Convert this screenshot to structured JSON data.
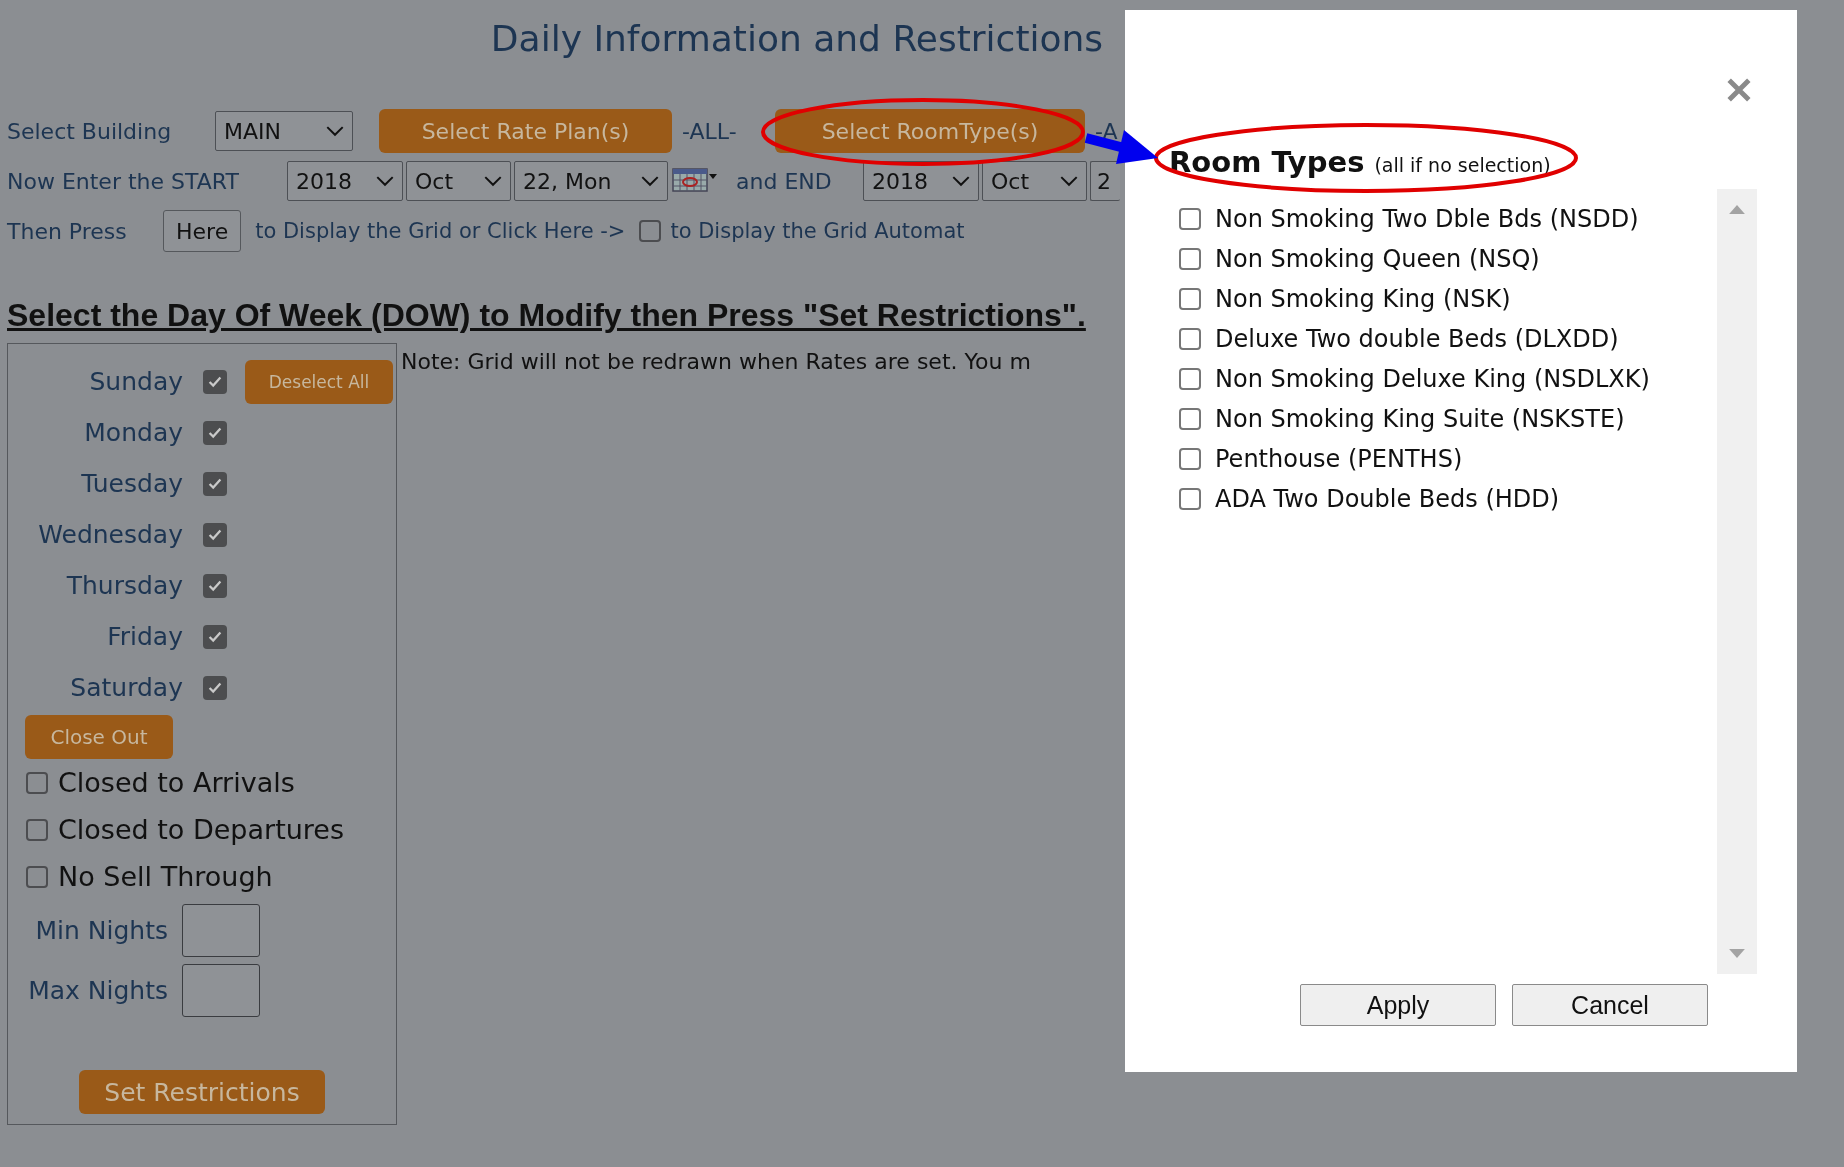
{
  "title": "Daily Information and Restrictions",
  "building": {
    "label": "Select Building",
    "value": "MAIN"
  },
  "rate_plan": {
    "button": "Select Rate Plan(s)",
    "value": "-ALL-"
  },
  "room_type": {
    "button": "Select RoomType(s)",
    "value": "-A"
  },
  "dates": {
    "start_label": "Now Enter the START",
    "start": [
      "2018",
      "Oct",
      "22, Mon"
    ],
    "end_label": "and END",
    "end": [
      "2018",
      "Oct",
      "2"
    ]
  },
  "display": {
    "prefix": "Then Press",
    "button": "Here",
    "middle": "to Display the Grid or Click Here ->",
    "auto_checked": false,
    "auto_label": "to Display the Grid Automat"
  },
  "heading": "Select the Day Of Week (DOW) to Modify then Press \"Set Restrictions\".",
  "note": "Note: Grid will not be redrawn when Rates are set. You m",
  "days": [
    {
      "label": "Sunday",
      "checked": true
    },
    {
      "label": "Monday",
      "checked": true
    },
    {
      "label": "Tuesday",
      "checked": true
    },
    {
      "label": "Wednesday",
      "checked": true
    },
    {
      "label": "Thursday",
      "checked": true
    },
    {
      "label": "Friday",
      "checked": true
    },
    {
      "label": "Saturday",
      "checked": true
    }
  ],
  "deselect_button": "Deselect All",
  "close_out_button": "Close Out",
  "restrictions": [
    {
      "label": "Closed to Arrivals",
      "checked": false
    },
    {
      "label": "Closed to Departures",
      "checked": false
    },
    {
      "label": "No Sell Through",
      "checked": false
    }
  ],
  "nights": [
    {
      "label": "Min Nights"
    },
    {
      "label": "Max Nights"
    }
  ],
  "set_button": "Set Restrictions",
  "modal": {
    "title": "Room Types",
    "hint": "(all if no selection)",
    "room_types": [
      {
        "label": "Non Smoking Two Dble Bds (NSDD)",
        "checked": false
      },
      {
        "label": "Non Smoking Queen (NSQ)",
        "checked": false
      },
      {
        "label": "Non Smoking King (NSK)",
        "checked": false
      },
      {
        "label": "Deluxe Two double Beds (DLXDD)",
        "checked": false
      },
      {
        "label": "Non Smoking Deluxe King (NSDLXK)",
        "checked": false
      },
      {
        "label": "Non Smoking King Suite (NSKSTE)",
        "checked": false
      },
      {
        "label": "Penthouse (PENTHS)",
        "checked": false
      },
      {
        "label": "ADA Two Double Beds (HDD)",
        "checked": false
      }
    ],
    "buttons": [
      "Apply",
      "Cancel"
    ]
  }
}
